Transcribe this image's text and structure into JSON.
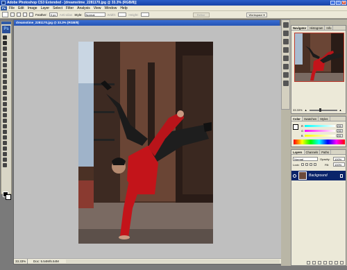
{
  "window": {
    "title": "Adobe Photoshop CS3 Extended - [dreamstime_2281170.jpg @ 33.3% (RGB/8)]",
    "buttons": [
      "_",
      "□",
      "x"
    ]
  },
  "menu": {
    "badge": "Ps",
    "items": [
      "File",
      "Edit",
      "Image",
      "Layer",
      "Select",
      "Filter",
      "Analysis",
      "View",
      "Window",
      "Help"
    ]
  },
  "options": {
    "feather_label": "Feather:",
    "feather_value": "0 px",
    "antialias_label": "Anti-alias",
    "style_label": "Style:",
    "style_value": "Normal",
    "width_label": "Width:",
    "height_label": "Height:",
    "refine_label": "Refine Edge...",
    "workspace_label": "Workspace ▾"
  },
  "toolbox": {
    "logo": "Ps"
  },
  "document": {
    "title": "dreamstime_2281170.jpg @ 33.3% (RGB/8)",
    "zoom": "33.33%",
    "doc_info": "Doc: 5.54M/5.54M"
  },
  "navigator": {
    "tabs": [
      "Navigator",
      "Histogram",
      "Info"
    ],
    "zoom": "33.33%"
  },
  "color": {
    "tabs": [
      "Color",
      "Swatches",
      "Styles"
    ],
    "channels": [
      {
        "label": "R",
        "value": "255"
      },
      {
        "label": "G",
        "value": "255"
      },
      {
        "label": "B",
        "value": "255"
      }
    ]
  },
  "layers": {
    "tabs": [
      "Layers",
      "Channels",
      "Paths"
    ],
    "blend_mode": "Normal",
    "opacity_label": "Opacity:",
    "opacity_value": "100%",
    "lock_label": "Lock:",
    "fill_label": "Fill:",
    "fill_value": "100%",
    "layer_name": "Background"
  },
  "colors": {
    "title_blue": "#2453b5",
    "layer_selected": "#0a246a",
    "chrome": "#ece9d8",
    "canvas_grey": "#bfbfbf"
  }
}
